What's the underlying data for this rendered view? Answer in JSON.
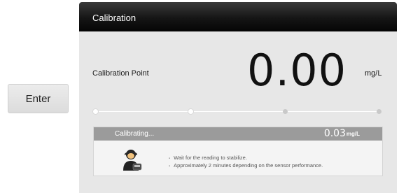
{
  "enter_button": {
    "label": "Enter"
  },
  "window": {
    "title": "Calibration"
  },
  "calibration": {
    "point_label": "Calibration Point",
    "value": "0.00",
    "unit": "mg/L",
    "steps_total": 4,
    "steps_completed": 2
  },
  "status": {
    "label": "Calibrating...",
    "reading": "0.03",
    "unit": "mg/L",
    "instructions": [
      "Wait for the reading to stabilize.",
      "Approximately 2 minutes depending on the sensor performance."
    ]
  },
  "icons": {
    "status_icon": "person-with-sensor-icon"
  },
  "colors": {
    "titlebar": "#111111",
    "panel": "#e7e7e7",
    "status_bar": "#9b9b9b"
  }
}
